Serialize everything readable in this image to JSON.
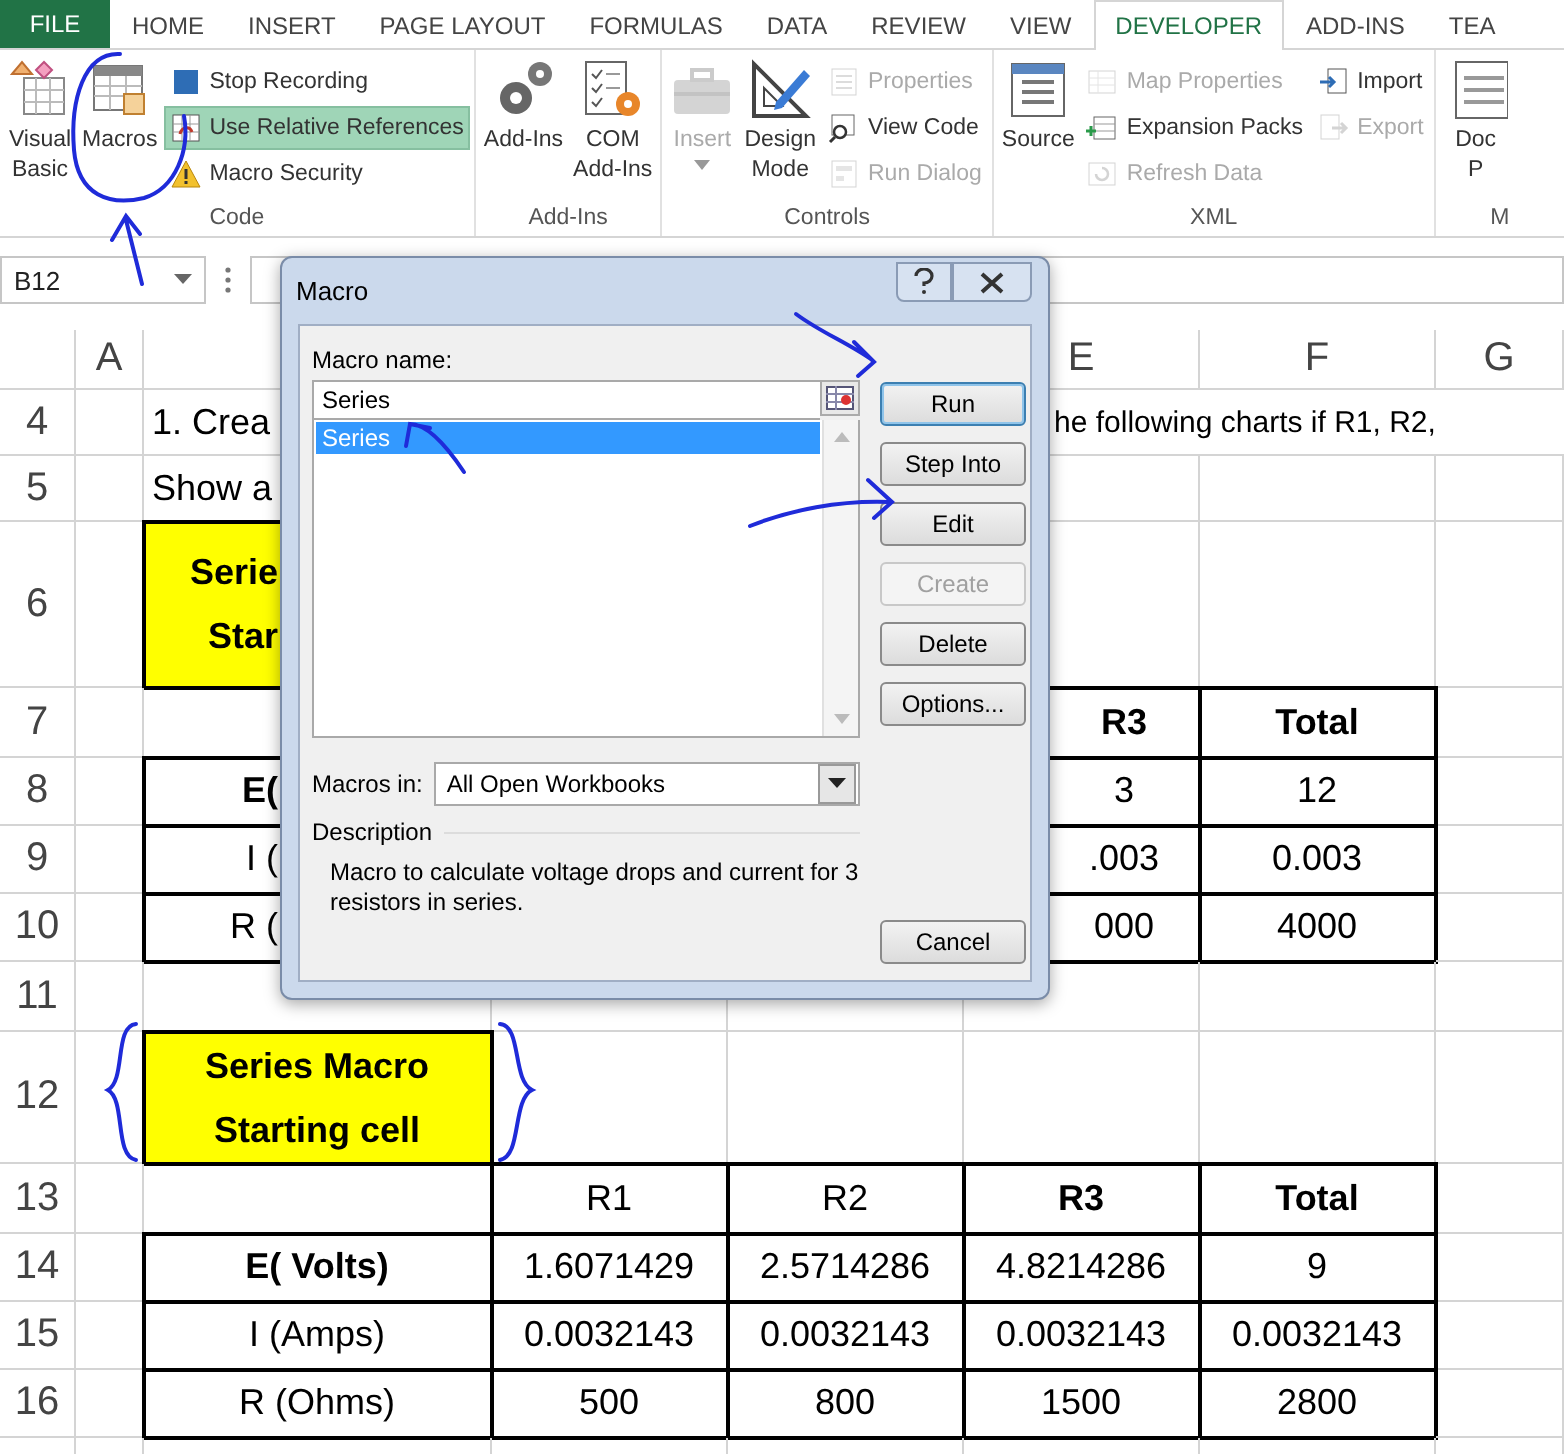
{
  "ribbon": {
    "file_tab": "FILE",
    "tabs": [
      {
        "label": "HOME",
        "selected": false
      },
      {
        "label": "INSERT",
        "selected": false
      },
      {
        "label": "PAGE LAYOUT",
        "selected": false
      },
      {
        "label": "FORMULAS",
        "selected": false
      },
      {
        "label": "DATA",
        "selected": false
      },
      {
        "label": "REVIEW",
        "selected": false
      },
      {
        "label": "VIEW",
        "selected": false
      },
      {
        "label": "DEVELOPER",
        "selected": true
      },
      {
        "label": "ADD-INS",
        "selected": false
      },
      {
        "label": "TEA",
        "selected": false
      }
    ],
    "groups": [
      {
        "label": "Code",
        "columns": [
          {
            "kind": "large",
            "lines": [
              "Visual",
              "Basic"
            ],
            "disabled": false
          },
          {
            "kind": "large",
            "lines": [
              "Macros"
            ],
            "disabled": false
          },
          {
            "kind": "stack",
            "items": [
              {
                "label": "Stop Recording",
                "on": false,
                "disabled": false
              },
              {
                "label": "Use Relative References",
                "on": true,
                "disabled": false
              },
              {
                "label": "Macro Security",
                "on": false,
                "disabled": false
              }
            ]
          }
        ]
      },
      {
        "label": "Add-Ins",
        "columns": [
          {
            "kind": "large",
            "lines": [
              "Add-Ins"
            ],
            "disabled": false
          },
          {
            "kind": "large",
            "lines": [
              "COM",
              "Add-Ins"
            ],
            "disabled": false
          }
        ]
      },
      {
        "label": "Controls",
        "columns": [
          {
            "kind": "large",
            "lines": [
              "Insert"
            ],
            "disabled": true,
            "dropdown": true
          },
          {
            "kind": "large",
            "lines": [
              "Design",
              "Mode"
            ],
            "disabled": false
          },
          {
            "kind": "stack",
            "items": [
              {
                "label": "Properties",
                "on": false,
                "disabled": true
              },
              {
                "label": "View Code",
                "on": false,
                "disabled": false
              },
              {
                "label": "Run Dialog",
                "on": false,
                "disabled": true
              }
            ]
          }
        ]
      },
      {
        "label": "XML",
        "columns": [
          {
            "kind": "large",
            "lines": [
              "Source"
            ],
            "disabled": false
          },
          {
            "kind": "stack",
            "items": [
              {
                "label": "Map Properties",
                "on": false,
                "disabled": true
              },
              {
                "label": "Expansion Packs",
                "on": false,
                "disabled": false
              },
              {
                "label": "Refresh Data",
                "on": false,
                "disabled": true
              }
            ]
          },
          {
            "kind": "stack",
            "items": [
              {
                "label": "Import",
                "on": false,
                "disabled": false
              },
              {
                "label": "Export",
                "on": false,
                "disabled": true
              }
            ]
          }
        ]
      },
      {
        "label": "M",
        "columns": [
          {
            "kind": "large",
            "lines": [
              "Doc",
              "P"
            ],
            "disabled": false
          }
        ]
      }
    ]
  },
  "formula_bar": {
    "name_box": "B12"
  },
  "sheet": {
    "column_headers": [
      "A",
      "E",
      "F",
      "G"
    ],
    "rows": [
      {
        "number": "4",
        "kind": "note",
        "left": "1. Crea",
        "right": "he following charts if R1, R2,"
      },
      {
        "number": "5",
        "kind": "note",
        "left": "Show a"
      },
      {
        "number": "6",
        "kind": "cliphighlight",
        "lines": [
          "Serie",
          "Star"
        ]
      },
      {
        "number": "7",
        "kind": "header",
        "r3": "R3",
        "total": "Total"
      },
      {
        "number": "8",
        "kind": "data",
        "bold": true,
        "label": "E(",
        "r3": "3",
        "total": "12"
      },
      {
        "number": "9",
        "kind": "data",
        "bold": false,
        "label": "I (",
        "r3": ".003",
        "total": "0.003"
      },
      {
        "number": "10",
        "kind": "data",
        "bold": false,
        "label": "R (",
        "r3": "000",
        "total": "4000"
      },
      {
        "number": "11",
        "kind": "blank"
      },
      {
        "number": "12",
        "kind": "highlight",
        "lines": [
          "Series Macro",
          "Starting cell"
        ]
      },
      {
        "number": "13",
        "kind": "header",
        "r1": "R1",
        "r2": "R2",
        "r3": "R3",
        "total": "Total"
      },
      {
        "number": "14",
        "kind": "data",
        "bold": true,
        "label": "E( Volts)",
        "r1": "1.6071429",
        "r2": "2.5714286",
        "r3": "4.8214286",
        "total": "9"
      },
      {
        "number": "15",
        "kind": "data",
        "bold": false,
        "label": "I (Amps)",
        "r1": "0.0032143",
        "r2": "0.0032143",
        "r3": "0.0032143",
        "total": "0.0032143"
      },
      {
        "number": "16",
        "kind": "data",
        "bold": false,
        "label": "R (Ohms)",
        "r1": "500",
        "r2": "800",
        "r3": "1500",
        "total": "2800"
      }
    ]
  },
  "dialog": {
    "title": "Macro",
    "name_label": "Macro name:",
    "name_value": "Series",
    "macros": [
      {
        "label": "Series",
        "selected": true
      }
    ],
    "buttons": [
      {
        "label": "Run",
        "default": true,
        "disabled": false
      },
      {
        "label": "Step Into",
        "default": false,
        "disabled": false
      },
      {
        "label": "Edit",
        "default": false,
        "disabled": false
      },
      {
        "label": "Create",
        "default": false,
        "disabled": true
      },
      {
        "label": "Delete",
        "default": false,
        "disabled": false
      },
      {
        "label": "Options...",
        "default": false,
        "disabled": false
      }
    ],
    "macros_in_label": "Macros in:",
    "macros_in_value": "All Open Workbooks",
    "description_label": "Description",
    "description": "Macro to calculate voltage drops and current for 3 resistors in series.",
    "cancel": "Cancel"
  }
}
